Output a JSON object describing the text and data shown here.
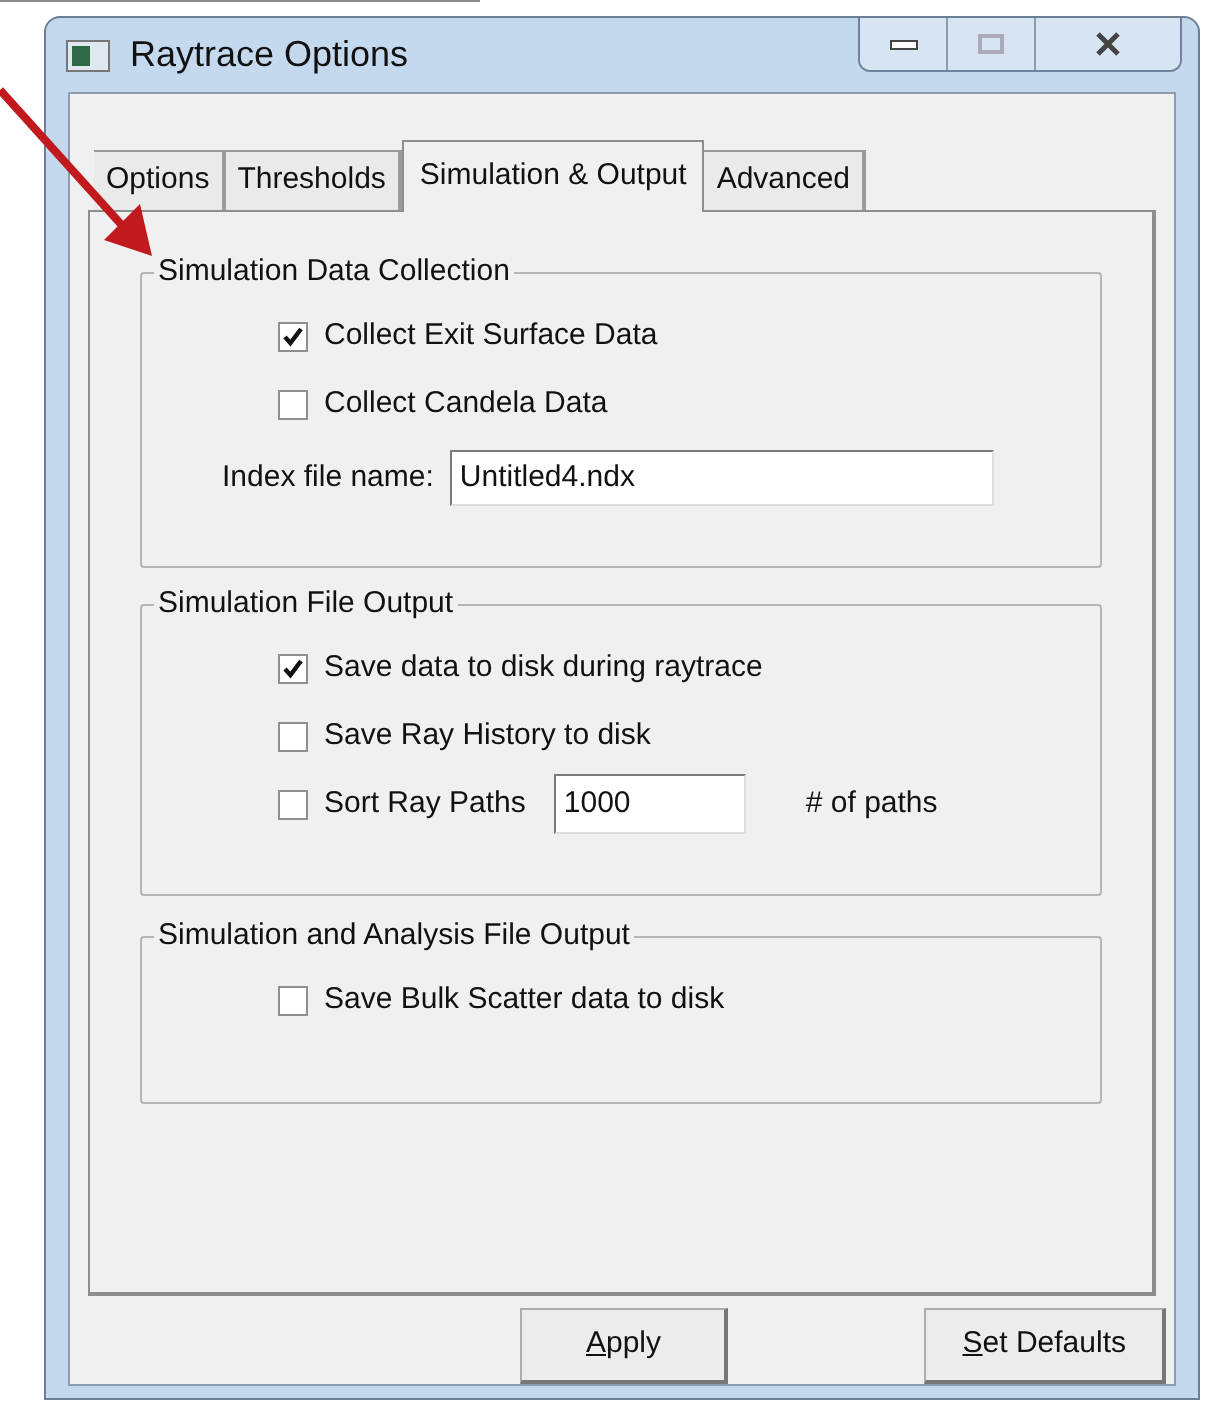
{
  "window": {
    "title": "Raytrace Options"
  },
  "tabs": [
    {
      "label": "Options",
      "selected": false
    },
    {
      "label": "Thresholds",
      "selected": false
    },
    {
      "label": "Simulation & Output",
      "selected": true
    },
    {
      "label": "Advanced",
      "selected": false
    }
  ],
  "groups": [
    {
      "title": "Simulation Data Collection",
      "items": [
        {
          "kind": "checkbox",
          "label": "Collect Exit Surface Data",
          "checked": true
        },
        {
          "kind": "checkbox",
          "label": "Collect Candela Data",
          "checked": false
        },
        {
          "kind": "field",
          "label": "Index file name:",
          "value": "Untitled4.ndx"
        }
      ]
    },
    {
      "title": "Simulation File Output",
      "items": [
        {
          "kind": "checkbox",
          "label": "Save data to disk during raytrace",
          "checked": true
        },
        {
          "kind": "checkbox",
          "label": "Save Ray History to disk",
          "checked": false
        },
        {
          "kind": "checkbox_field",
          "label": "Sort Ray Paths",
          "checked": false,
          "value": "1000",
          "suffix": "# of paths"
        }
      ]
    },
    {
      "title": "Simulation and Analysis File Output",
      "items": [
        {
          "kind": "checkbox",
          "label": "Save Bulk Scatter data to disk",
          "checked": false
        }
      ]
    }
  ],
  "buttons": [
    {
      "access_key": "A",
      "rest": "pply"
    },
    {
      "access_key": "S",
      "rest": "et Defaults"
    }
  ]
}
